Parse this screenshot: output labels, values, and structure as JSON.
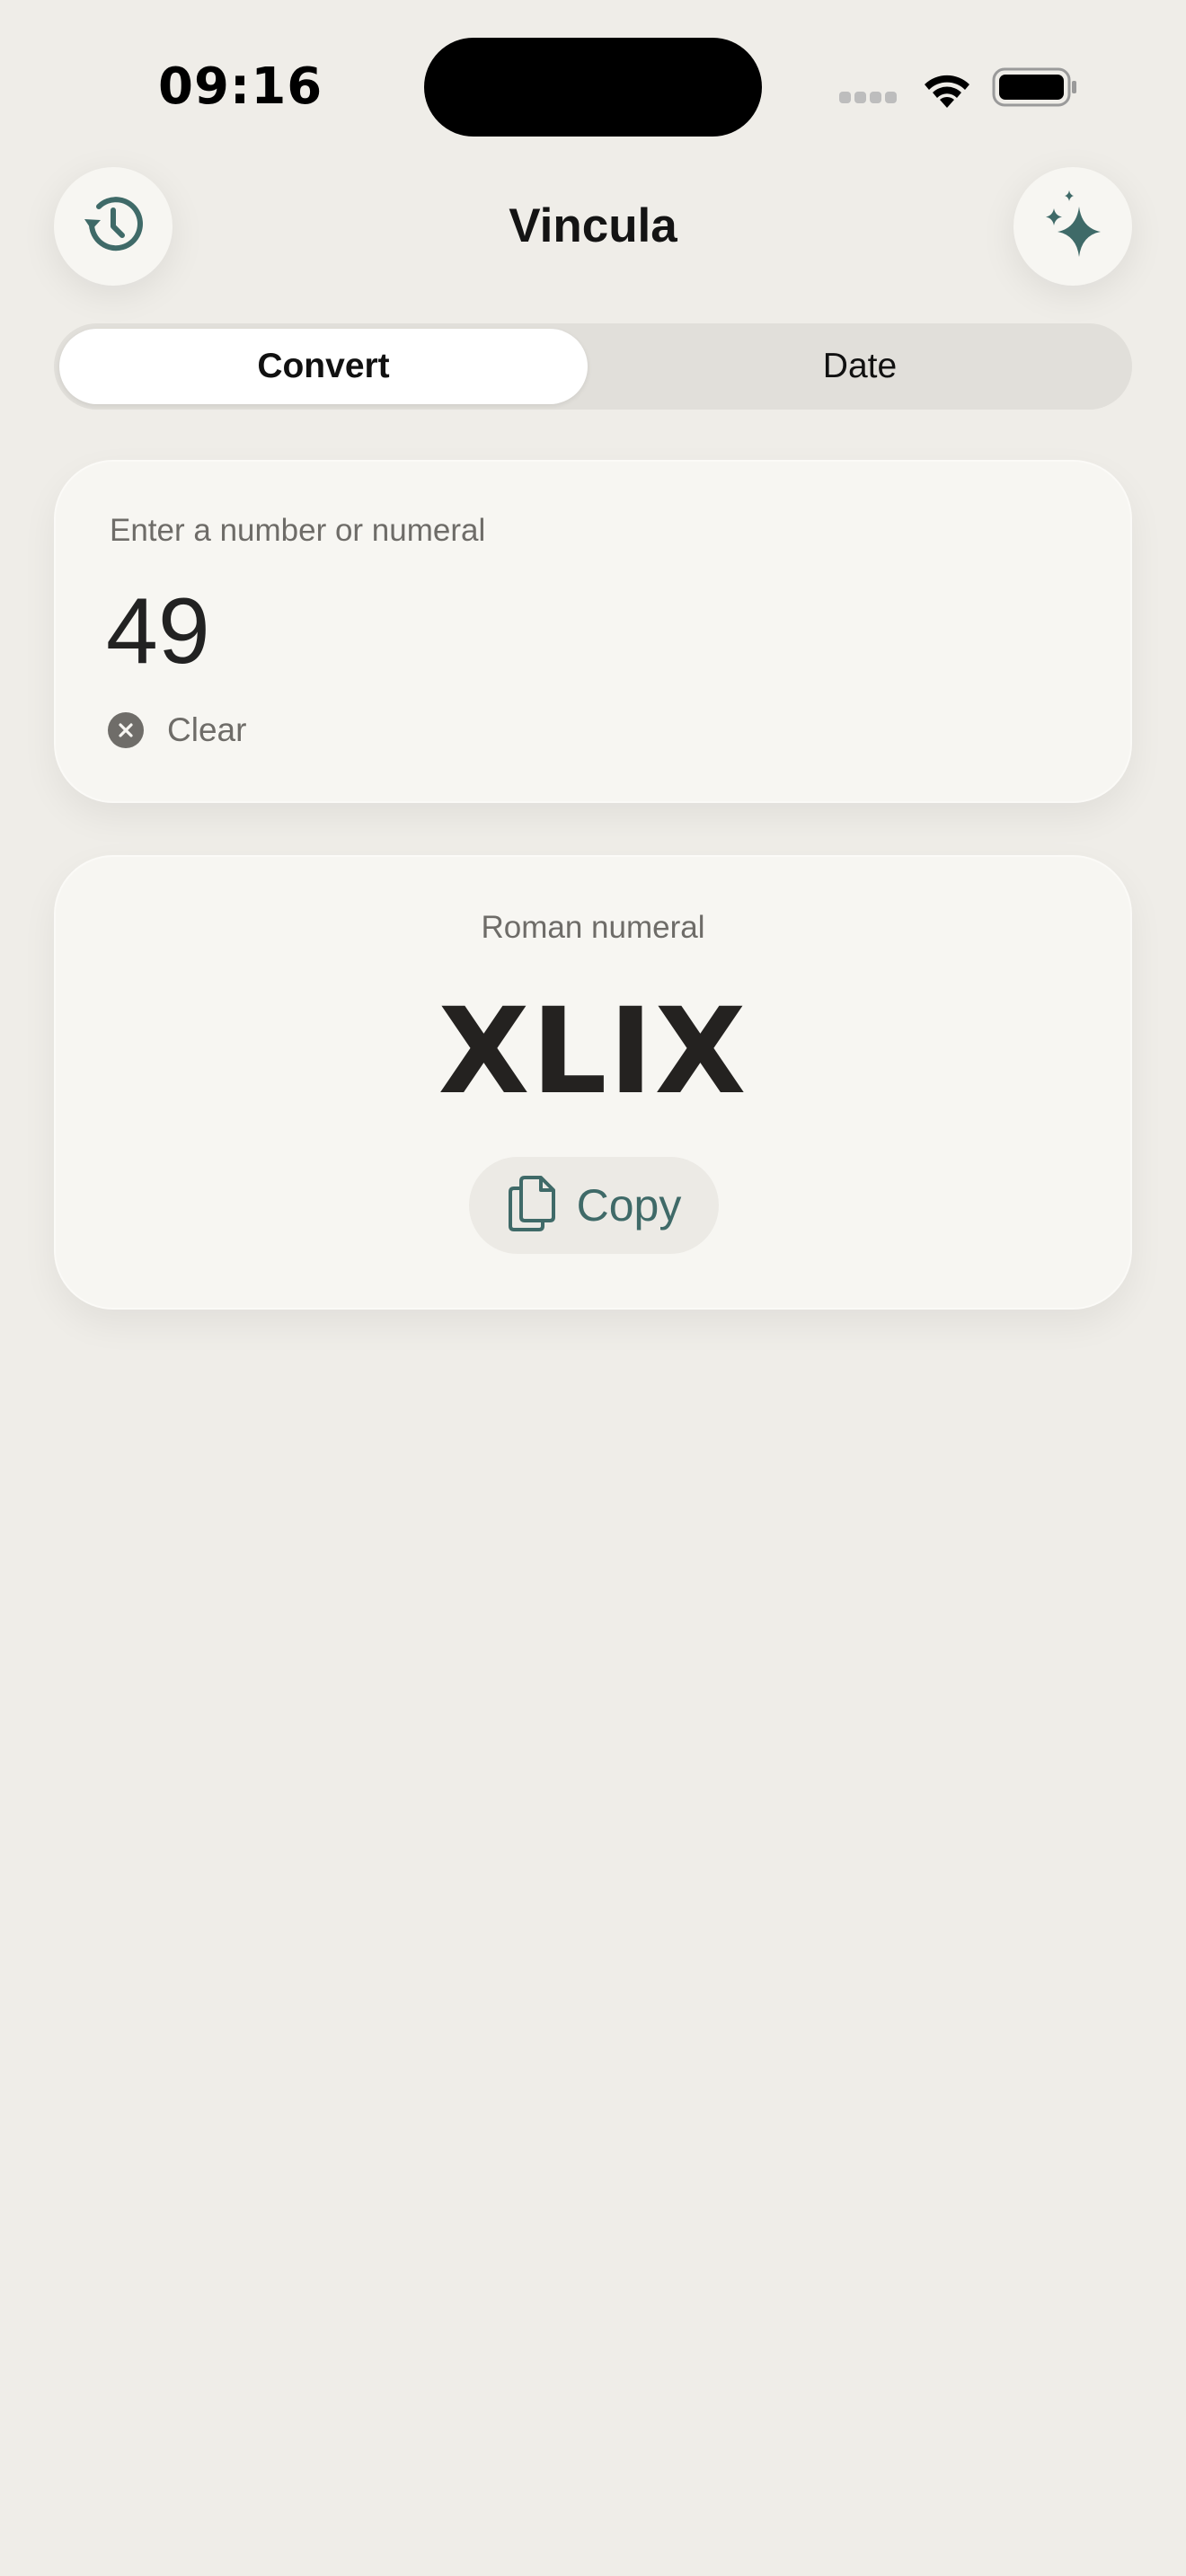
{
  "status_bar": {
    "time": "09:16",
    "icons": [
      "cellular-signal-icon",
      "wifi-icon",
      "battery-icon"
    ]
  },
  "header": {
    "title": "Vincula",
    "left_button_icon": "history-icon",
    "right_button_icon": "sparkles-icon"
  },
  "tabs": [
    {
      "label": "Convert",
      "selected": true
    },
    {
      "label": "Date",
      "selected": false
    }
  ],
  "input": {
    "label": "Enter a number or numeral",
    "value": "49",
    "clear_label": "Clear"
  },
  "result": {
    "label": "Roman numeral",
    "value": "XLIX",
    "copy_label": "Copy"
  },
  "colors": {
    "background": "#EFEDE8",
    "card": "#F7F6F2",
    "accent": "#3F6A68",
    "text_primary": "#141414",
    "text_secondary": "#6E6C68"
  }
}
